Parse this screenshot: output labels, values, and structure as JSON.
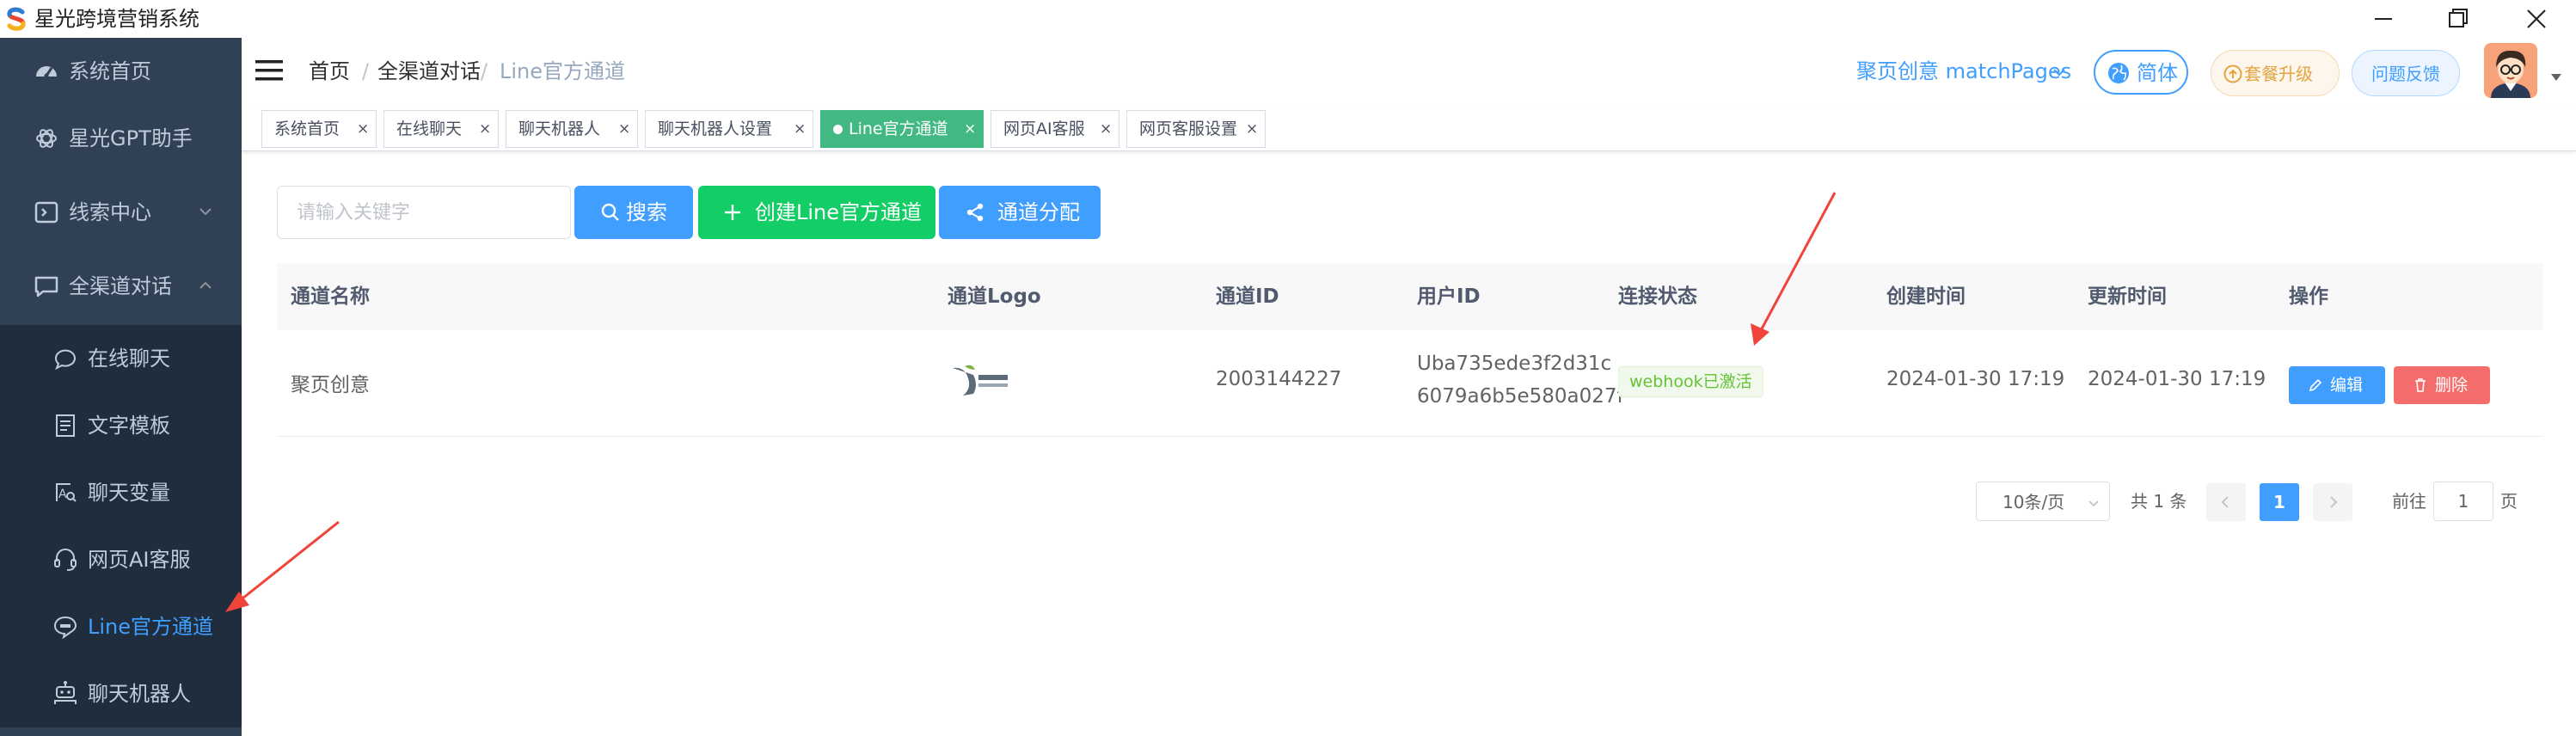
{
  "window": {
    "title": "星光跨境营销系统"
  },
  "sidebar": {
    "items": [
      {
        "label": "系统首页",
        "icon": "dashboard-icon"
      },
      {
        "label": "星光GPT助手",
        "icon": "openai-icon"
      },
      {
        "label": "线索中心",
        "icon": "clue-icon",
        "expanded": false
      },
      {
        "label": "全渠道对话",
        "icon": "chat-icon",
        "expanded": true
      },
      {
        "label": "在线聊天",
        "icon": "message-icon"
      },
      {
        "label": "文字模板",
        "icon": "document-icon"
      },
      {
        "label": "聊天变量",
        "icon": "variable-icon"
      },
      {
        "label": "网页AI客服",
        "icon": "headset-icon"
      },
      {
        "label": "Line官方通道",
        "icon": "line-icon",
        "active": true
      },
      {
        "label": "聊天机器人",
        "icon": "robot-icon"
      }
    ]
  },
  "header": {
    "breadcrumb": [
      "首页",
      "全渠道对话",
      "Line官方通道"
    ],
    "breadcrumb_separator": "/",
    "brand": "聚页创意 matchPages",
    "lang": "简体",
    "upgrade": "套餐升级",
    "feedback": "问题反馈"
  },
  "tags": [
    {
      "label": "系统首页"
    },
    {
      "label": "在线聊天"
    },
    {
      "label": "聊天机器人"
    },
    {
      "label": "聊天机器人设置"
    },
    {
      "label": "Line官方通道",
      "active": true
    },
    {
      "label": "网页AI客服"
    },
    {
      "label": "网页客服设置"
    }
  ],
  "tag_close": "×",
  "toolbar": {
    "search_placeholder": "请输入关键字",
    "search_button": "搜索",
    "create_button": "创建Line官方通道",
    "assign_button": "通道分配"
  },
  "table": {
    "headers": [
      "通道名称",
      "通道Logo",
      "通道ID",
      "用户ID",
      "连接状态",
      "创建时间",
      "更新时间",
      "操作"
    ],
    "rows": [
      {
        "name": "聚页创意",
        "channel_id": "2003144227",
        "user_id_line1": "Uba735ede3f2d31c",
        "user_id_line2": "6079a6b5e580a027f",
        "status": "webhook已激活",
        "created": "2024-01-30 17:19",
        "updated": "2024-01-30 17:19",
        "edit": "编辑",
        "delete": "删除"
      }
    ]
  },
  "pagination": {
    "page_size": "10条/页",
    "total": "共 1 条",
    "current_page": "1",
    "goto_label": "前往",
    "goto_value": "1",
    "goto_suffix": "页"
  },
  "colors": {
    "primary": "#409eff",
    "success": "#13ce66",
    "danger": "#f56c6c",
    "sidebar_bg": "#304156",
    "submenu_bg": "#1f2d3d",
    "active_tag": "#42b983",
    "annotation_arrow": "#f0443a"
  }
}
